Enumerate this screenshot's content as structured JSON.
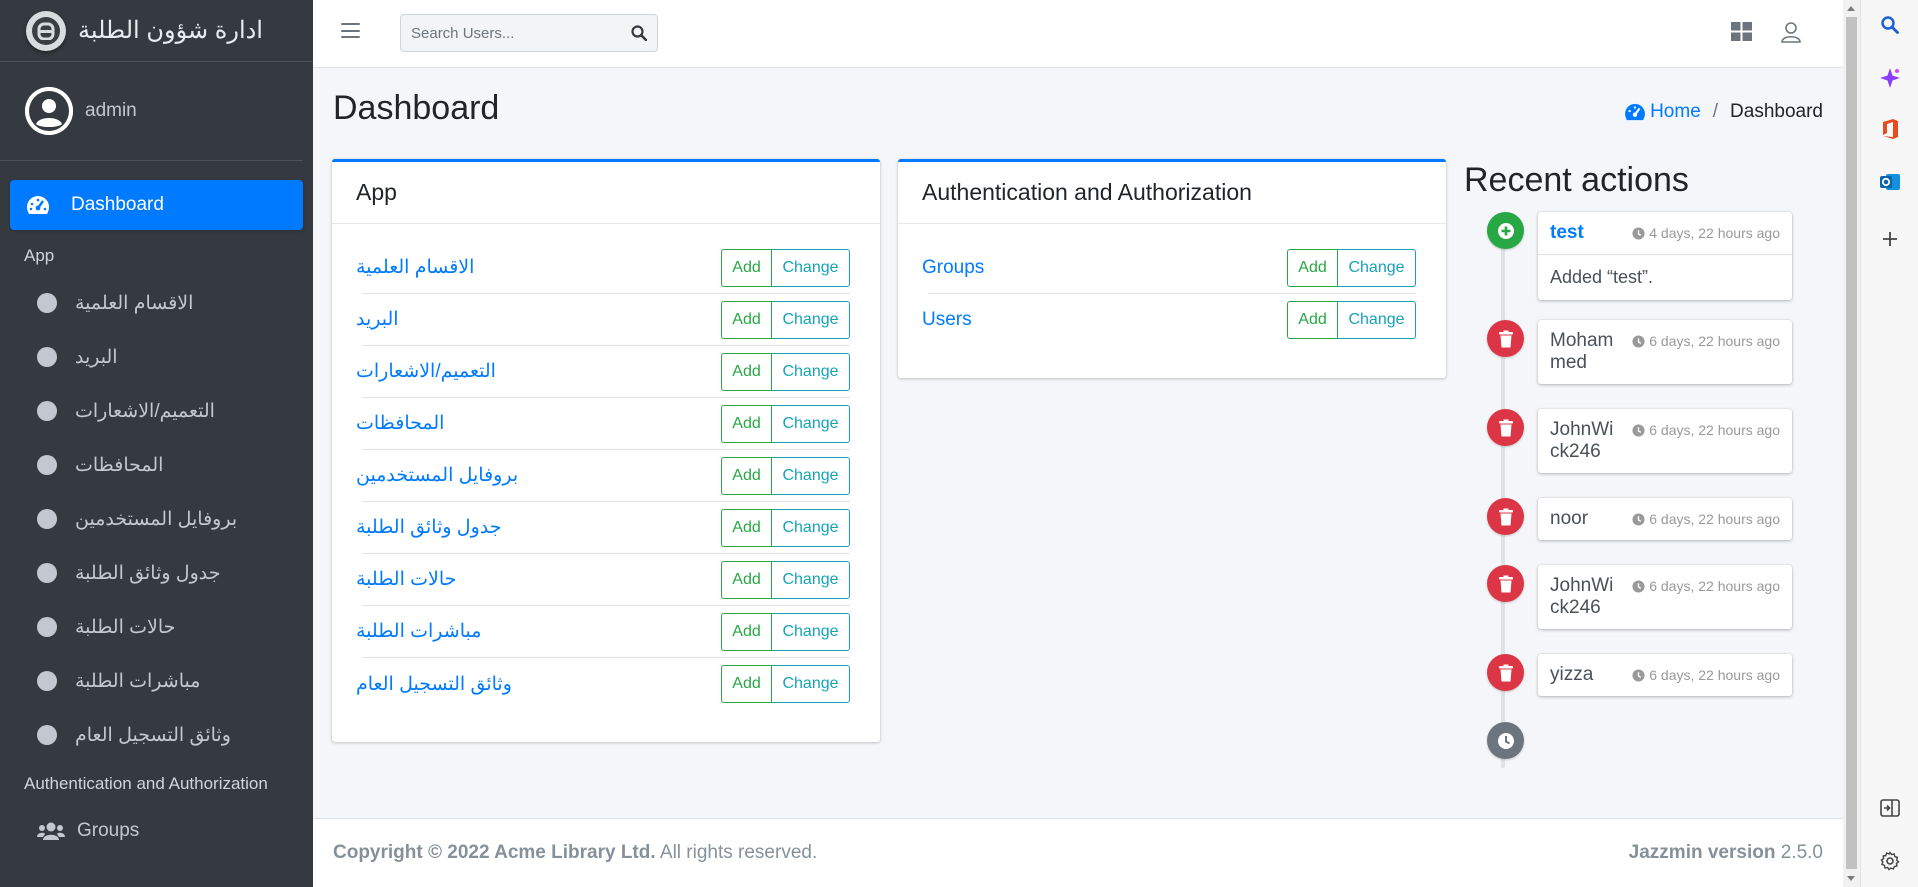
{
  "brand": {
    "title": "ادارة شؤون الطلبة"
  },
  "user": {
    "name": "admin"
  },
  "sidebar": {
    "dashboard_label": "Dashboard",
    "app_header": "App",
    "app_items": [
      "الاقسام العلمية",
      "البريد",
      "التعميم/الاشعارات",
      "المحافظات",
      "بروفايل المستخدمين",
      "جدول وثائق الطلبة",
      "حالات الطلبة",
      "مباشرات الطلبة",
      "وثائق التسجيل العام"
    ],
    "auth_header": "Authentication and Authorization",
    "groups_label": "Groups"
  },
  "topbar": {
    "search_placeholder": "Search Users..."
  },
  "page": {
    "title": "Dashboard"
  },
  "breadcrumb": {
    "home": "Home",
    "current": "Dashboard"
  },
  "app_card": {
    "title": "App",
    "add_label": "Add",
    "change_label": "Change",
    "models": [
      "الاقسام العلمية",
      "البريد",
      "التعميم/الاشعارات",
      "المحافظات",
      "بروفايل المستخدمين",
      "جدول وثائق الطلبة",
      "حالات الطلبة",
      "مباشرات الطلبة",
      "وثائق التسجيل العام"
    ]
  },
  "auth_card": {
    "title": "Authentication and Authorization",
    "add_label": "Add",
    "change_label": "Change",
    "models": [
      "Groups",
      "Users"
    ]
  },
  "recent": {
    "title": "Recent actions",
    "items": [
      {
        "name": "test",
        "time": "4 days, 22 hours ago",
        "body": "Added “test”.",
        "type": "add"
      },
      {
        "name": "Mohammed",
        "time": "6 days, 22 hours ago",
        "type": "delete"
      },
      {
        "name": "JohnWick246",
        "time": "6 days, 22 hours ago",
        "type": "delete"
      },
      {
        "name": "noor",
        "time": "6 days, 22 hours ago",
        "type": "delete"
      },
      {
        "name": "JohnWick246",
        "time": "6 days, 22 hours ago",
        "type": "delete"
      },
      {
        "name": "yizza",
        "time": "6 days, 22 hours ago",
        "type": "delete"
      }
    ]
  },
  "footer": {
    "copyright": "Copyright © 2022 Acme Library Ltd.",
    "rights": "All rights reserved.",
    "version_label": "Jazzmin version",
    "version": "2.5.0"
  },
  "colors": {
    "primary": "#007bff",
    "success": "#28a745",
    "danger": "#dc3545",
    "info": "#17a2b8",
    "sidebar": "#343a40"
  }
}
